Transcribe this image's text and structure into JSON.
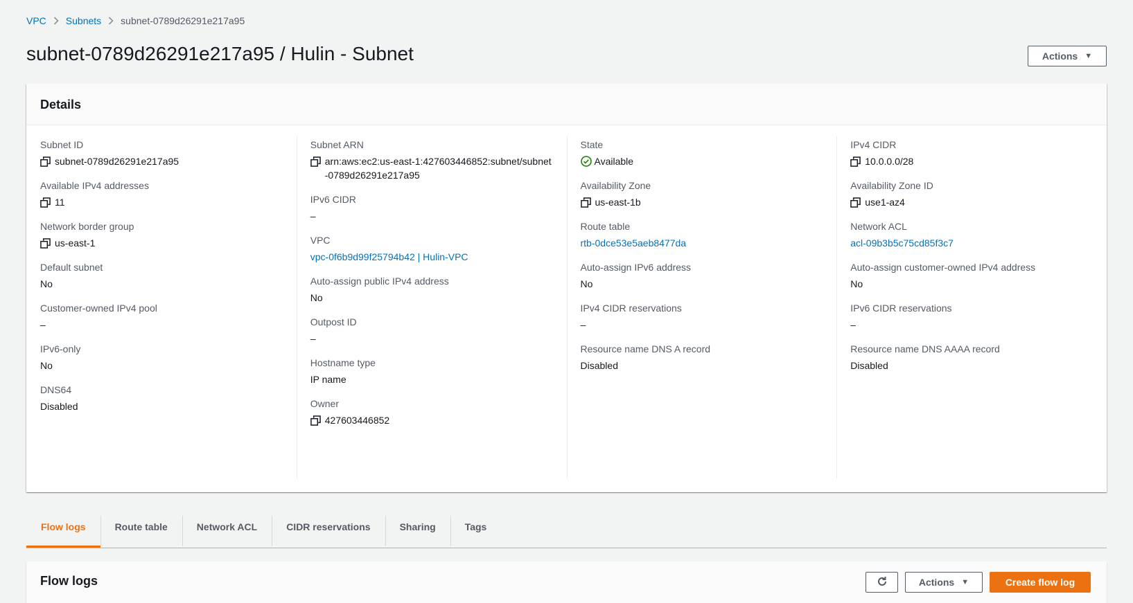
{
  "breadcrumb": {
    "items": [
      "VPC",
      "Subnets"
    ],
    "current": "subnet-0789d26291e217a95"
  },
  "page": {
    "title": "subnet-0789d26291e217a95 / Hulin - Subnet",
    "actions_label": "Actions"
  },
  "details": {
    "heading": "Details",
    "columns": [
      [
        {
          "label": "Subnet ID",
          "value": "subnet-0789d26291e217a95",
          "copy": true
        },
        {
          "label": "Available IPv4 addresses",
          "value": "11",
          "copy": true
        },
        {
          "label": "Network border group",
          "value": "us-east-1",
          "copy": true
        },
        {
          "label": "Default subnet",
          "value": "No"
        },
        {
          "label": "Customer-owned IPv4 pool",
          "value": "–"
        },
        {
          "label": "IPv6-only",
          "value": "No"
        },
        {
          "label": "DNS64",
          "value": "Disabled"
        }
      ],
      [
        {
          "label": "Subnet ARN",
          "value": "arn:aws:ec2:us-east-1:427603446852:subnet/subnet-0789d26291e217a95",
          "copy": true
        },
        {
          "label": "IPv6 CIDR",
          "value": "–"
        },
        {
          "label": "VPC",
          "value": "vpc-0f6b9d99f25794b42 | Hulin-VPC",
          "link": true
        },
        {
          "label": "Auto-assign public IPv4 address",
          "value": "No"
        },
        {
          "label": "Outpost ID",
          "value": "–"
        },
        {
          "label": "Hostname type",
          "value": "IP name"
        },
        {
          "label": "Owner",
          "value": "427603446852",
          "copy": true
        }
      ],
      [
        {
          "label": "State",
          "value": "Available",
          "status": "success"
        },
        {
          "label": "Availability Zone",
          "value": "us-east-1b",
          "copy": true
        },
        {
          "label": "Route table",
          "value": "rtb-0dce53e5aeb8477da",
          "link": true
        },
        {
          "label": "Auto-assign IPv6 address",
          "value": "No"
        },
        {
          "label": "IPv4 CIDR reservations",
          "value": "–"
        },
        {
          "label": "Resource name DNS A record",
          "value": "Disabled"
        }
      ],
      [
        {
          "label": "IPv4 CIDR",
          "value": "10.0.0.0/28",
          "copy": true
        },
        {
          "label": "Availability Zone ID",
          "value": "use1-az4",
          "copy": true
        },
        {
          "label": "Network ACL",
          "value": "acl-09b3b5c75cd85f3c7",
          "link": true
        },
        {
          "label": "Auto-assign customer-owned IPv4 address",
          "value": "No"
        },
        {
          "label": "IPv6 CIDR reservations",
          "value": "–"
        },
        {
          "label": "Resource name DNS AAAA record",
          "value": "Disabled"
        }
      ]
    ]
  },
  "tabs": [
    {
      "label": "Flow logs",
      "active": true
    },
    {
      "label": "Route table"
    },
    {
      "label": "Network ACL"
    },
    {
      "label": "CIDR reservations"
    },
    {
      "label": "Sharing"
    },
    {
      "label": "Tags"
    }
  ],
  "flow_logs": {
    "title": "Flow logs",
    "actions_label": "Actions",
    "create_label": "Create flow log"
  },
  "colors": {
    "accent": "#ec7211",
    "link": "#0073bb",
    "success": "#1d8102"
  }
}
